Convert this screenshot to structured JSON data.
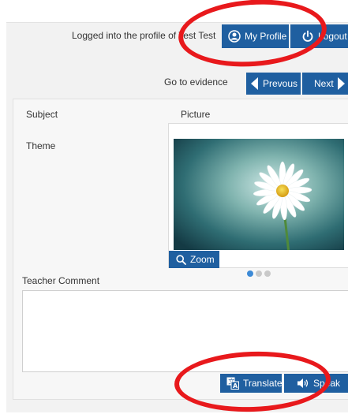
{
  "header": {
    "logged_in_text": "Logged into the profile of Test Test",
    "my_profile_label": "My Profile",
    "logout_label": "Logout"
  },
  "nav": {
    "go_to_evidence": "Go to evidence",
    "previous_label": "Prevous",
    "next_label": "Next"
  },
  "labels": {
    "subject": "Subject",
    "theme": "Theme",
    "picture": "Picture",
    "teacher_comment": "Teacher Comment"
  },
  "picture": {
    "zoom_label": "Zoom",
    "carousel_dots": 3,
    "active_dot": 1
  },
  "actions": {
    "translate_label": "Translate",
    "speak_label": "Speak"
  },
  "colors": {
    "button_blue": "#1f5fa0",
    "annotation_red": "#e8191c",
    "active_dot": "#3d8ad6"
  },
  "icons": {
    "profile": "user-circle-icon",
    "logout": "power-icon",
    "previous": "arrow-left-icon",
    "next": "arrow-right-icon",
    "zoom": "magnifier-icon",
    "translate": "translate-icon",
    "speak": "speaker-icon"
  }
}
